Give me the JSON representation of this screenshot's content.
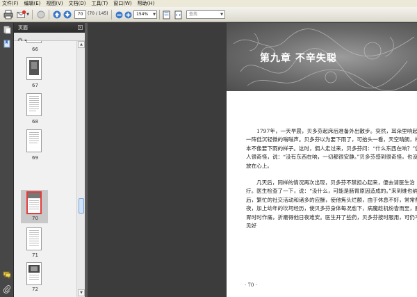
{
  "menu": [
    "文件(F)",
    "编辑(E)",
    "视图(V)",
    "文档(D)",
    "工具(T)",
    "窗口(W)",
    "帮助(H)"
  ],
  "toolbar": {
    "page_number": "70",
    "page_count": "(70 / 145)",
    "zoom": "154%",
    "search_placeholder": "查找"
  },
  "panel": {
    "title": "页面",
    "thumbnails": [
      {
        "label": "66"
      },
      {
        "label": "67"
      },
      {
        "label": "68"
      },
      {
        "label": "69"
      },
      {
        "label": "70",
        "selected": true
      },
      {
        "label": "71"
      },
      {
        "label": "72"
      }
    ]
  },
  "page": {
    "chapter_title": "第九章  不辛失聪",
    "paragraphs": [
      "1797年，一天早晨，贝多芬起床后准备外出散步。突然，耳朵里响起一阵低沉轻微的嗡嗡声。贝多芬以为要下雨了，可抬头一看，天空晴朗，根本不像要下雨的样子。这时，佣人走过来，贝多芬问：“什么东西在响？”佣人很奇怪，说：“没有东西在响，一切都很安静。”贝多芬感到很奇怪，也没放在心上。",
      "几天后，同样的情况再次出现，贝多芬不禁担心起来，便去请医生治疗。医生检查了一下，说：“没什么，可能是肠胃原因造成的。”来到维也纳后，繁忙的社交活动和诸多的应酬，使他焦头烂额，由于休息不好，常常熬夜，加上幼年的坎坷经历，使贝多芬身体每况愈下，病魔趁机纷沓而至，肠胃时时作痛，折磨得他日夜难安。医生开了些药，贝多芬按时服用，可仍不见好"
    ],
    "folio": "· 70 ·"
  }
}
